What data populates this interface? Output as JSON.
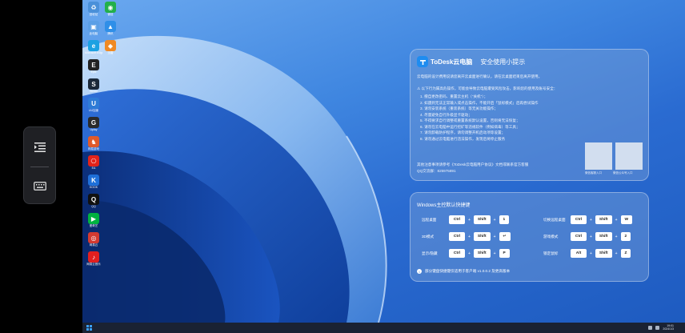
{
  "panel1": {
    "brand": "ToDesk云电脑",
    "title": "安全使用小提示",
    "intro": "云电脑的设计费用说请您离开云桌面进行确认，请在云桌面结束后离开使用。",
    "warning": "以下行为属高危操作，可能会导致云电脑遭受风险攻击，影响您的使用及账号安全：",
    "items": [
      "1. 擅自更改密码、重置云主机（\"关机\"）；",
      "2. 如遇到无法正常输入或点击操作，不能开启「鼠标模式」后再尝试操作",
      "3. 请勿安装系统（重装系统）等无关功能操作；",
      "4. 尽量避免自行升级显卡驱动；",
      "5. 不得要求自行调整或重置系统默认设置，否则将无法恢复；",
      "6. 请勿在云电脑中运行挖矿等违规软件（例如病毒）等工具；",
      "7. 请勿卸载防护程序，请勿调整开机启动项等设置；",
      "8. 请勿通过云电脑进行违法操作，发现后将停止服务"
    ],
    "footer1": "其他注意事项请参考《ToDesk云电脑用户协议》文档或联系官方客服",
    "footer2": "QQ交流群：825975891",
    "qr1_label": "微信客服入口",
    "qr2_label": "微信公众号入口"
  },
  "panel2": {
    "title": "Windows主控默认快捷键",
    "rows_left": [
      {
        "label": "远程桌面",
        "keys": [
          "Ctrl",
          "Shift",
          "1"
        ]
      },
      {
        "label": "3D模式",
        "keys": [
          "Ctrl",
          "Shift",
          "↵"
        ]
      },
      {
        "label": "显示/隐藏",
        "keys": [
          "Ctrl",
          "Shift",
          "P"
        ]
      }
    ],
    "rows_right": [
      {
        "label": "切换远程桌面",
        "keys": [
          "Ctrl",
          "Shift",
          "W"
        ]
      },
      {
        "label": "游戏模式",
        "keys": [
          "Ctrl",
          "Shift",
          "2"
        ]
      },
      {
        "label": "锁定鼠标",
        "keys": [
          "Alt",
          "Shift",
          "Z"
        ]
      }
    ],
    "footer": "部分键盘快捷键仅适用于客户端 v1.0.0.2 及更高版本"
  },
  "desktop_icons": [
    {
      "label": "回收站",
      "color": "#4a90d9",
      "glyph": "♻"
    },
    {
      "label": "微信",
      "color": "#23b04b",
      "glyph": "◉"
    },
    {
      "label": "此电脑",
      "color": "#5b9fe6",
      "glyph": "▣"
    },
    {
      "label": "腾讯",
      "color": "#2f8fe8",
      "glyph": "▲"
    },
    {
      "label": "Microsoft Edge",
      "color": "#1ba1e2",
      "glyph": "e"
    },
    {
      "label": "迅雷",
      "color": "#f08a24",
      "glyph": "◆"
    },
    {
      "label": "Epic",
      "color": "#222222",
      "glyph": "E"
    },
    {
      "label": "Steam",
      "color": "#1b2838",
      "glyph": "S"
    },
    {
      "label": "UU加速",
      "color": "#2e7bd6",
      "glyph": "U"
    },
    {
      "label": "Uplay",
      "color": "#2a2a2a",
      "glyph": "G"
    },
    {
      "label": "网易游戏",
      "color": "#e05a2b",
      "glyph": "♞"
    },
    {
      "label": "EA",
      "color": "#e2231a",
      "glyph": "⎔"
    },
    {
      "label": "KOOK",
      "color": "#1e6fd9",
      "glyph": "K"
    },
    {
      "label": "QQ",
      "color": "#111111",
      "glyph": "Q"
    },
    {
      "label": "爱奇艺",
      "color": "#00b140",
      "glyph": "▶"
    },
    {
      "label": "网易云",
      "color": "#d33a31",
      "glyph": "◎"
    },
    {
      "label": "网易云音乐",
      "color": "#e21f1f",
      "glyph": "♪"
    }
  ],
  "taskbar": {
    "time": "19:01",
    "date": "2024/1/3"
  },
  "colors": {
    "panel_bg": "#78a0d7",
    "accent": "#1e8cf0",
    "taskbar": "#1a2233"
  }
}
